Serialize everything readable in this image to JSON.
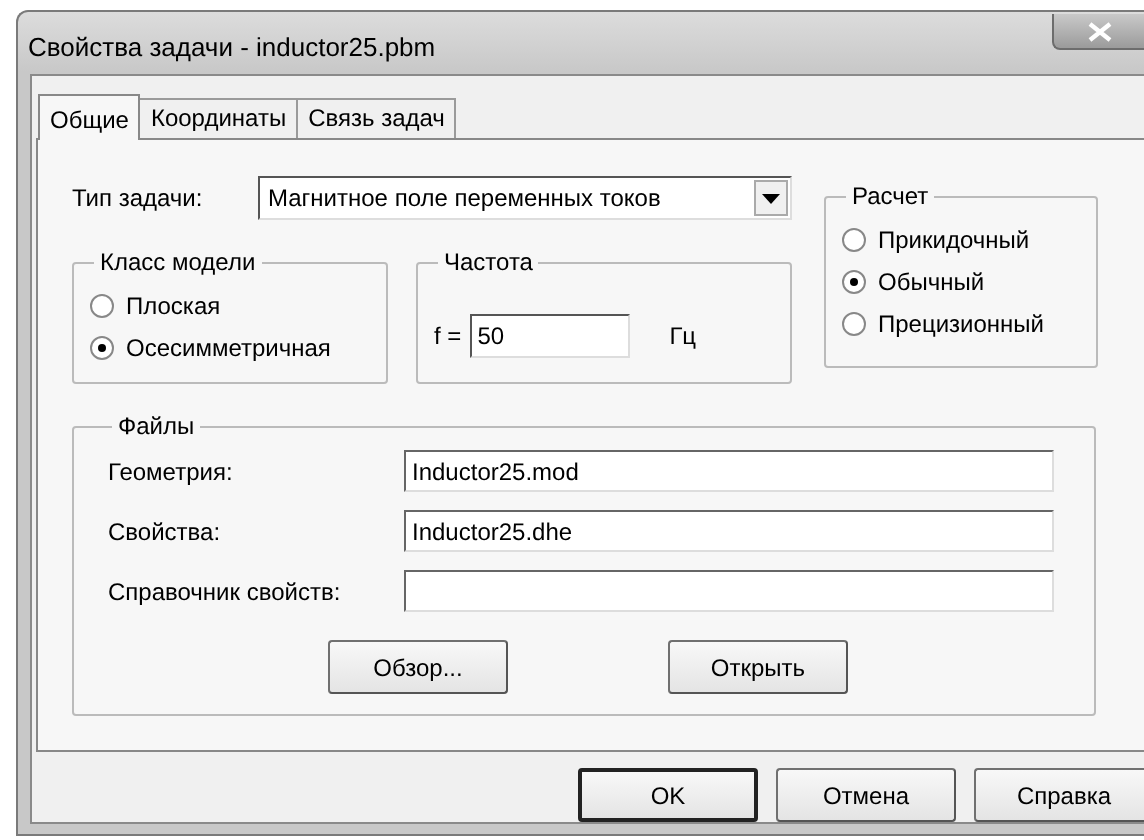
{
  "window": {
    "title": "Свойства задачи - inductor25.pbm"
  },
  "tabs": [
    {
      "label": "Общие",
      "selected": true
    },
    {
      "label": "Координаты",
      "selected": false
    },
    {
      "label": "Связь задач",
      "selected": false
    }
  ],
  "task_type": {
    "label": "Тип задачи:",
    "value": "Магнитное поле переменных токов"
  },
  "model_class": {
    "title": "Класс модели",
    "options": [
      {
        "label": "Плоская",
        "selected": false
      },
      {
        "label": "Осесимметричная",
        "selected": true
      }
    ]
  },
  "frequency": {
    "title": "Частота",
    "prefix": "f =",
    "value": "50",
    "unit": "Гц"
  },
  "calculation": {
    "title": "Расчет",
    "options": [
      {
        "label": "Прикидочный",
        "selected": false
      },
      {
        "label": "Обычный",
        "selected": true
      },
      {
        "label": "Прецизионный",
        "selected": false
      }
    ]
  },
  "files": {
    "title": "Файлы",
    "rows": [
      {
        "label": "Геометрия:",
        "value": "Inductor25.mod"
      },
      {
        "label": "Свойства:",
        "value": "Inductor25.dhe"
      },
      {
        "label": "Справочник свойств:"
      }
    ],
    "buttons": [
      "Обзор...",
      "Открыть"
    ]
  },
  "buttons": [
    {
      "label": "OK",
      "default": true
    },
    {
      "label": "Отмена",
      "default": false
    },
    {
      "label": "Справка",
      "default": false
    }
  ]
}
